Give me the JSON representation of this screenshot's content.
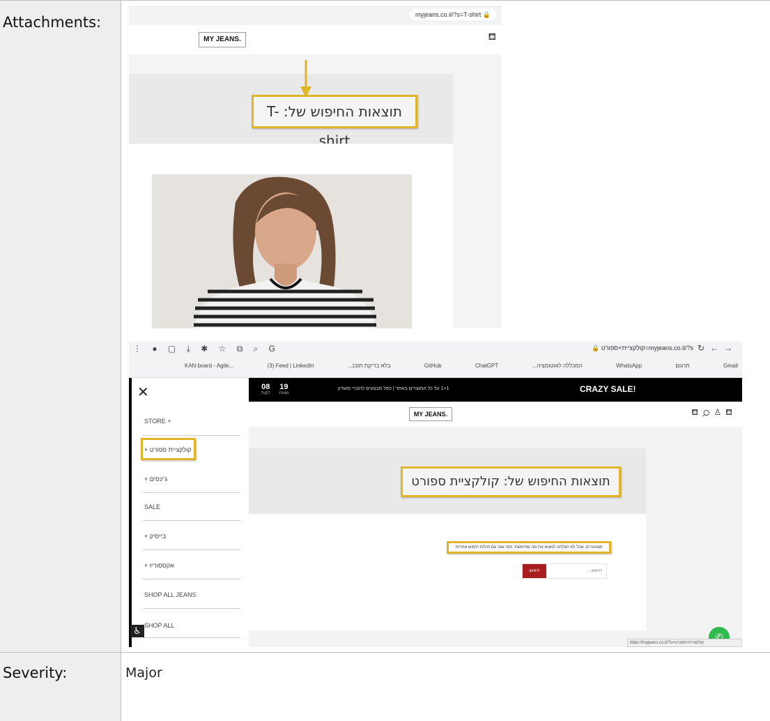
{
  "report": {
    "attachments_label": "Attachments:",
    "severity_label": "Severity:",
    "severity_value": "Major"
  },
  "shot1": {
    "url": "myjeans.co.il/?s=T-shirt",
    "logo": "MY JEANS.",
    "search_result_title": "תוצאות החיפוש של: T-shirt",
    "accent_color": "#e2b529"
  },
  "shot2": {
    "url": "myjeans.co.il/?s=קולקציית+ספורט",
    "bookmarks": [
      "KAN board - Agile...",
      "(3) Feed | LinkedIn",
      "...בלא בדיקת תוכנ",
      "GitHub",
      "ChatGPT",
      "...המכללה לאוטומציה",
      "WhatsApp",
      "תרגום",
      "Gmail"
    ],
    "sale_banner": "CRAZY SALE!",
    "promo_text": "1+1 על כל המוצרים באתר | כפל מבצעים לחברי מועדון",
    "timer": {
      "minutes": "08",
      "minutes_unit": "דקות",
      "hours": "19",
      "hours_unit": "שעות"
    },
    "logo": "MY JEANS.",
    "menu_items": [
      "STORE +",
      "+ קולקציית ספורט",
      "+ ג'ינסים",
      "SALE",
      "+ בייסיק",
      "+ אקססוריז",
      "SHOP ALL JEANS",
      "SHOP ALL"
    ],
    "search_result_title": "תוצאות החיפוש של: קולקציית ספורט",
    "no_results_message": "מצטערים, אבל לא הצלחנו למצוא את מה שחיפשת. נסה שוב עם מילות חיפוש אחרות",
    "search_placeholder": "חיפוש...",
    "search_button": "חיפוש",
    "status_url": "https://myjeans.co.il/?s=קולקציית+ספורט",
    "brand_red": "#a81e1e"
  }
}
